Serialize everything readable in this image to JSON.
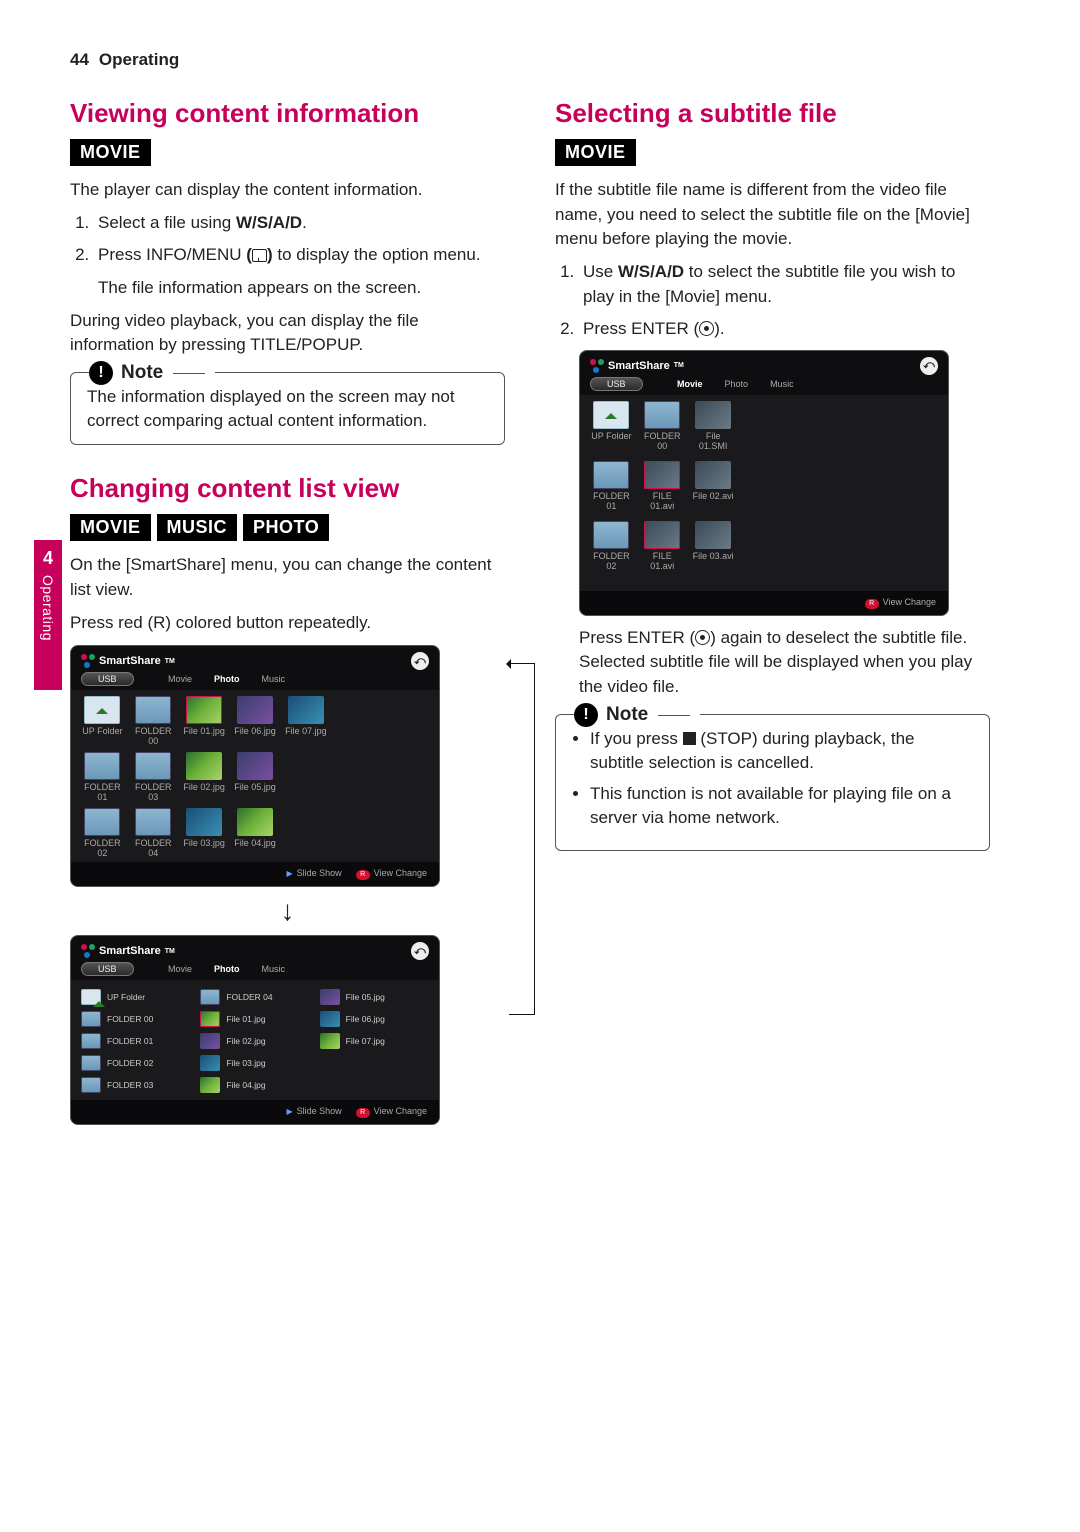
{
  "page": {
    "number": "44",
    "section": "Operating"
  },
  "sidebar": {
    "number": "4",
    "label": "Operating"
  },
  "left": {
    "s1": {
      "heading": "Viewing content information",
      "tags": [
        "MOVIE"
      ],
      "intro": "The player can display the content information.",
      "step1": "Select a file using ",
      "nav": "W/S/A/D",
      "step2a": "Press INFO/MENU ",
      "step2b": " to display the option menu.",
      "sub": "The file information appears on the screen.",
      "para": "During video playback, you can display the file information by pressing TITLE/POPUP.",
      "note": "The information displayed on the screen may not correct comparing actual content information."
    },
    "s2": {
      "heading": "Changing content list view",
      "tags": [
        "MOVIE",
        "MUSIC",
        "PHOTO"
      ],
      "p1": "On the [SmartShare] menu, you can change the content list view.",
      "p2": "Press red (R) colored button repeatedly."
    }
  },
  "right": {
    "s1": {
      "heading": "Selecting a subtitle file",
      "tags": [
        "MOVIE"
      ],
      "intro": "If the subtitle file name is different from the video file name, you need to select the subtitle file on the [Movie] menu before playing the movie.",
      "step1a": "Use ",
      "step1b": " to select the subtitle file you wish to play in the [Movie] menu.",
      "step2": "Press ENTER (",
      "step2end": ").",
      "after": "Press ENTER (",
      "after2": ") again to deselect the subtitle file. Selected subtitle file will be displayed when you play the video file.",
      "note1a": "If you press ",
      "note1b": " (STOP) during playback, the subtitle selection is cancelled.",
      "note2": "This function is not available for playing file on a server via home network."
    }
  },
  "note_label": "Note",
  "shots": {
    "brand": "SmartShare",
    "tm": "TM",
    "usb": "USB",
    "tabs": {
      "movie": "Movie",
      "photo": "Photo",
      "music": "Music"
    },
    "footer": {
      "slide": "Slide Show",
      "view": "View Change",
      "r": "R"
    },
    "grid": {
      "up": "UP Folder",
      "f00": "FOLDER 00",
      "f01": "FOLDER 01",
      "f02": "FOLDER 02",
      "f03": "FOLDER 03",
      "f04": "FOLDER 04",
      "i01": "File 01.jpg",
      "i02": "File 02.jpg",
      "i03": "File 03.jpg",
      "i04": "File 04.jpg",
      "i05": "File 05.jpg",
      "i06": "File 06.jpg",
      "i07": "File 07.jpg"
    },
    "movie": {
      "up": "UP Folder",
      "f00": "FOLDER 00",
      "f01": "FOLDER 01",
      "f02": "FOLDER 02",
      "m01": "File 01.SMI",
      "m02": "FILE 01.avi",
      "m03": "File 02.avi",
      "m04": "File 03.avi"
    }
  }
}
